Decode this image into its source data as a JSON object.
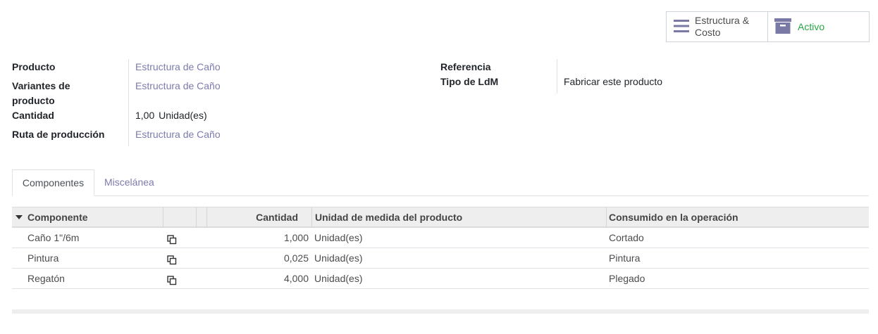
{
  "smart_buttons": {
    "bom_label_1": "Estructura &",
    "bom_label_2": "Costo",
    "active_label": "Activo"
  },
  "form": {
    "left": {
      "producto_label": "Producto",
      "producto_value": "Estructura de Caño",
      "variantes_label_1": "Variantes de",
      "variantes_label_2": "producto",
      "variantes_value": "Estructura de Caño",
      "cantidad_label": "Cantidad",
      "cantidad_value": "1,00",
      "cantidad_unit": "Unidad(es)",
      "ruta_label": "Ruta de producción",
      "ruta_value": "Estructura de Caño"
    },
    "right": {
      "referencia_label": "Referencia",
      "referencia_value": "",
      "tipo_label": "Tipo de LdM",
      "tipo_value": "Fabricar este producto"
    }
  },
  "tabs": [
    "Componentes",
    "Miscelánea"
  ],
  "table": {
    "headers": {
      "componente": "Componente",
      "cantidad": "Cantidad",
      "unidad": "Unidad de medida del producto",
      "operacion": "Consumido en la operación"
    },
    "rows": [
      {
        "componente": "Caño 1\"/6m",
        "cantidad": "1,000",
        "unidad": "Unidad(es)",
        "operacion": "Cortado"
      },
      {
        "componente": "Pintura",
        "cantidad": "0,025",
        "unidad": "Unidad(es)",
        "operacion": "Pintura"
      },
      {
        "componente": "Regatón",
        "cantidad": "4,000",
        "unidad": "Unidad(es)",
        "operacion": "Plegado"
      }
    ]
  },
  "colors": {
    "link": "#7c7bad",
    "active_green": "#28a745",
    "header_bg": "#eeeeee"
  },
  "icons": {
    "bom": "bars-icon",
    "archive": "archive-icon",
    "copy": "copy-icon",
    "sort": "caret-down-icon"
  }
}
